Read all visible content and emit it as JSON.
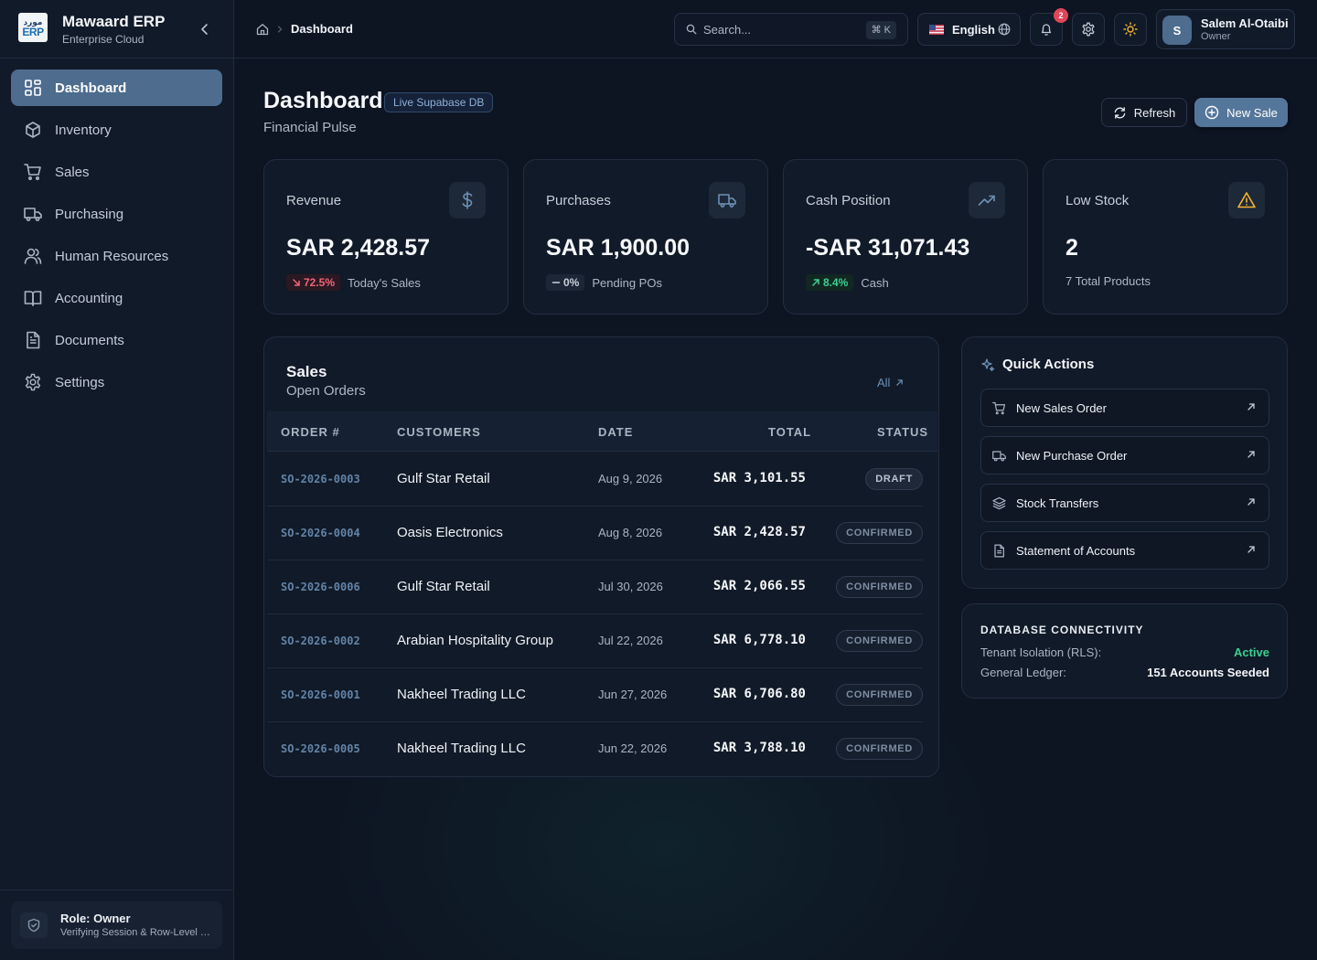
{
  "brand": {
    "logo_top": "مورد",
    "logo_bottom": "ERP",
    "name": "Mawaard ERP",
    "subtitle": "Enterprise Cloud"
  },
  "nav": [
    {
      "label": "Dashboard",
      "icon": "dashboard-grid-icon",
      "active": true
    },
    {
      "label": "Inventory",
      "icon": "package-icon"
    },
    {
      "label": "Sales",
      "icon": "cart-icon"
    },
    {
      "label": "Purchasing",
      "icon": "truck-icon"
    },
    {
      "label": "Human Resources",
      "icon": "users-icon"
    },
    {
      "label": "Accounting",
      "icon": "book-icon"
    },
    {
      "label": "Documents",
      "icon": "document-icon"
    },
    {
      "label": "Settings",
      "icon": "gear-icon"
    }
  ],
  "role": {
    "title": "Role: Owner",
    "subtitle": "Verifying Session & Row-Level Security"
  },
  "topbar": {
    "breadcrumb": {
      "current": "Dashboard"
    },
    "search": {
      "placeholder": "Search...",
      "shortcut": "⌘ K"
    },
    "language": "English",
    "notifications_count": "2",
    "user": {
      "initial": "S",
      "name": "Salem Al-Otaibi",
      "role": "Owner"
    }
  },
  "header": {
    "title": "Dashboard",
    "badge": "Live Supabase DB",
    "subtitle": "Financial Pulse",
    "refresh_label": "Refresh",
    "new_sale_label": "New Sale"
  },
  "kpis": [
    {
      "label": "Revenue",
      "value": "SAR 2,428.57",
      "change": "72.5%",
      "trend": "down",
      "note": "Today's Sales",
      "icon": "dollar-icon"
    },
    {
      "label": "Purchases",
      "value": "SAR 1,900.00",
      "change": "0%",
      "trend": "flat",
      "note": "Pending POs",
      "icon": "truck-icon"
    },
    {
      "label": "Cash Position",
      "value": "-SAR 31,071.43",
      "change": "8.4%",
      "trend": "up",
      "note": "Cash",
      "icon": "trending-up-icon"
    },
    {
      "label": "Low Stock",
      "value": "2",
      "note": "7 Total Products",
      "icon": "warning-icon"
    }
  ],
  "sales": {
    "title": "Sales",
    "subtitle": "Open Orders",
    "all_label": "All",
    "columns": [
      "ORDER #",
      "CUSTOMERS",
      "DATE",
      "TOTAL",
      "STATUS"
    ],
    "rows": [
      {
        "order": "SO-2026-0003",
        "customer": "Gulf Star Retail",
        "date": "Aug 9, 2026",
        "total": "SAR 3,101.55",
        "status": "DRAFT"
      },
      {
        "order": "SO-2026-0004",
        "customer": "Oasis Electronics",
        "date": "Aug 8, 2026",
        "total": "SAR 2,428.57",
        "status": "CONFIRMED"
      },
      {
        "order": "SO-2026-0006",
        "customer": "Gulf Star Retail",
        "date": "Jul 30, 2026",
        "total": "SAR 2,066.55",
        "status": "CONFIRMED"
      },
      {
        "order": "SO-2026-0002",
        "customer": "Arabian Hospitality Group",
        "date": "Jul 22, 2026",
        "total": "SAR 6,778.10",
        "status": "CONFIRMED"
      },
      {
        "order": "SO-2026-0001",
        "customer": "Nakheel Trading LLC",
        "date": "Jun 27, 2026",
        "total": "SAR 6,706.80",
        "status": "CONFIRMED"
      },
      {
        "order": "SO-2026-0005",
        "customer": "Nakheel Trading LLC",
        "date": "Jun 22, 2026",
        "total": "SAR 3,788.10",
        "status": "CONFIRMED"
      }
    ]
  },
  "quick_actions": {
    "title": "Quick Actions",
    "items": [
      {
        "label": "New Sales Order",
        "icon": "cart-icon"
      },
      {
        "label": "New Purchase Order",
        "icon": "truck-icon"
      },
      {
        "label": "Stock Transfers",
        "icon": "layers-icon"
      },
      {
        "label": "Statement of Accounts",
        "icon": "document-icon"
      }
    ]
  },
  "db": {
    "title": "DATABASE CONNECTIVITY",
    "rows": [
      {
        "key": "Tenant Isolation (RLS):",
        "value": "Active",
        "color": "#3ccf90"
      },
      {
        "key": "General Ledger:",
        "value": "151 Accounts Seeded",
        "color": "#f4f6f9"
      }
    ]
  },
  "colors": {
    "accent": "#4d6c8e",
    "positive": "#3ccf90",
    "negative": "#f0657a",
    "warning": "#f5b52e"
  }
}
